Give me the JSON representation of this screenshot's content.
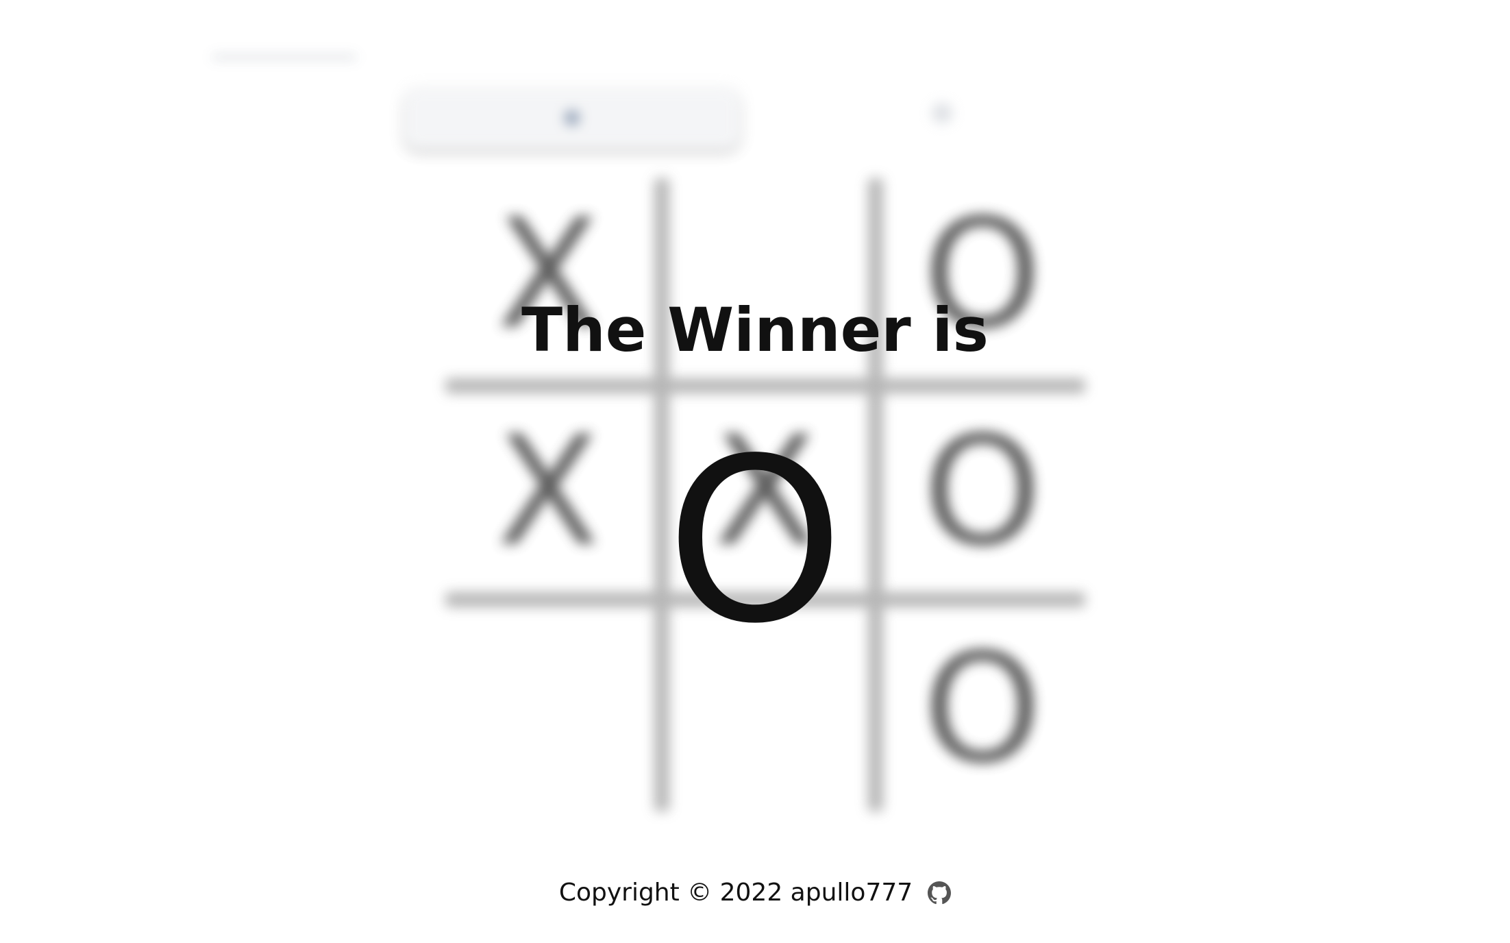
{
  "nav": {
    "home_label": "",
    "about_label": ""
  },
  "board": {
    "cells": [
      "X",
      "",
      "O",
      "X",
      "X",
      "O",
      "",
      "",
      "O"
    ]
  },
  "result": {
    "title": "The Winner is",
    "winner": "O"
  },
  "footer": {
    "copyright": "Copyright © 2022 apullo777",
    "icon": "github-icon"
  },
  "colors": {
    "text": "#111111",
    "blurred_mark": "#3f3f3f",
    "grid": "#a9a9a9"
  }
}
